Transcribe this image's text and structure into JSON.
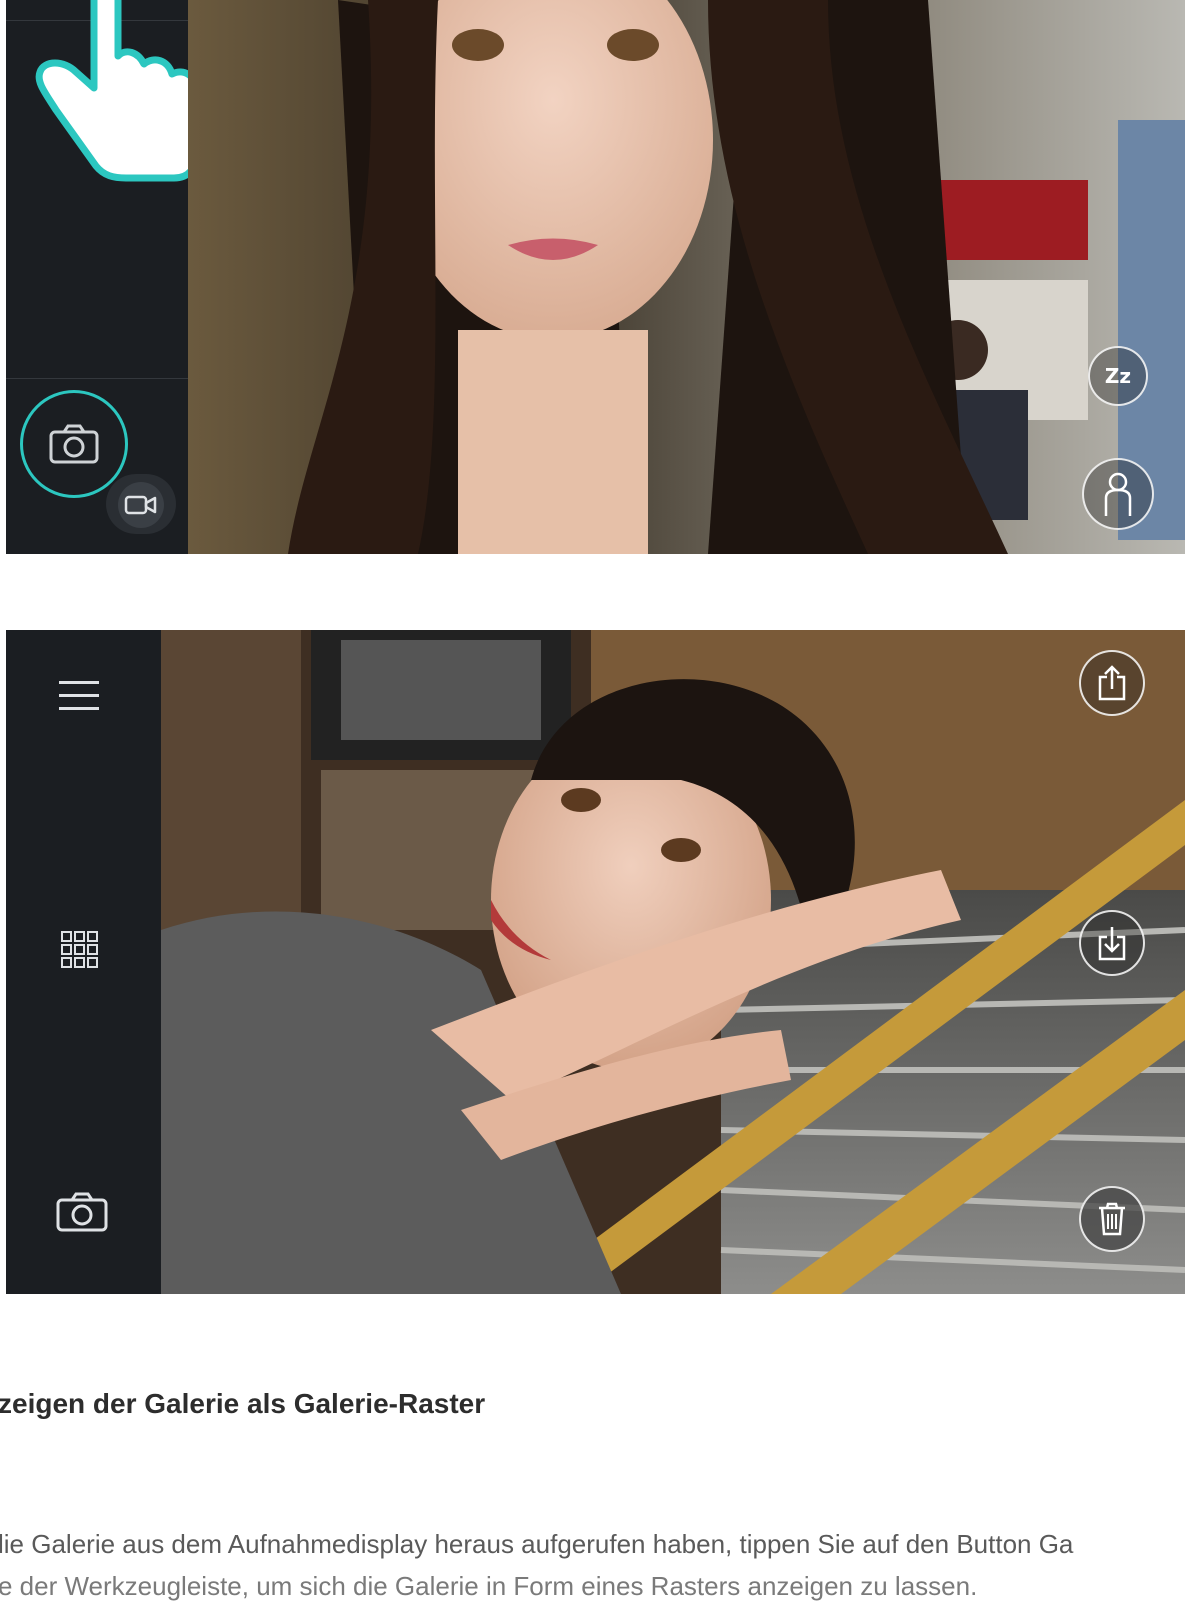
{
  "viewfinder": {
    "photo_shutter_icon": "camera-icon",
    "video_mode_icon": "video-camera-icon",
    "sleep_icon": "sleep-zzz-icon",
    "sleep_label": "Zz",
    "portrait_icon": "person-icon",
    "tap_gesture_icon": "pointing-hand-icon",
    "accent_color": "#2cc7c0"
  },
  "gallery": {
    "menu_icon": "hamburger-menu-icon",
    "grid_icon": "grid-icon",
    "camera_icon": "camera-icon",
    "share_icon": "share-icon",
    "download_icon": "download-icon",
    "delete_icon": "trash-icon"
  },
  "article": {
    "heading": "zeigen der Galerie als Galerie-Raster",
    "paragraph_line1": "lie Galerie aus dem Aufnahmedisplay heraus aufgerufen haben, tippen Sie auf den Button Ga",
    "paragraph_line2": "e der Werkzeugleiste, um sich die Galerie in Form eines Rasters anzeigen zu lassen."
  }
}
